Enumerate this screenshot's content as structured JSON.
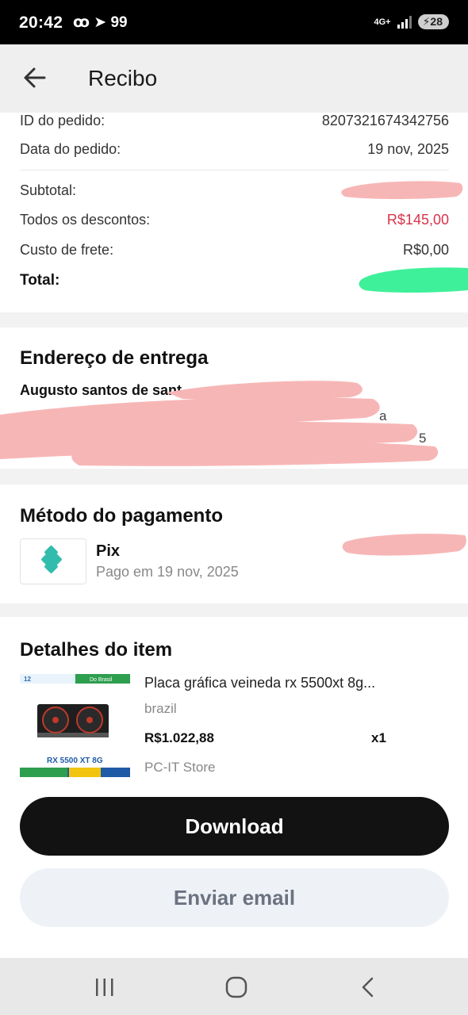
{
  "status_bar": {
    "time": "20:42",
    "icons_text": "ꝏ ➤ 99",
    "network": "4G+",
    "battery": "28"
  },
  "header": {
    "back_icon": "arrow-left-icon",
    "title": "Recibo"
  },
  "summary": {
    "order_id_label": "ID do pedido:",
    "order_id_value": "8207321674342756",
    "order_date_label": "Data do pedido:",
    "order_date_value": "19 nov, 2025",
    "subtotal_label": "Subtotal:",
    "discounts_label": "Todos os descontos:",
    "discounts_value": "R$145,00",
    "shipping_label": "Custo de frete:",
    "shipping_value": "R$0,00",
    "total_label": "Total:",
    "discount_color": "#d8334a"
  },
  "address": {
    "title": "Endereço de entrega",
    "name": "Augusto santos de sant",
    "line1_tail": "a",
    "line2_tail": "5"
  },
  "payment": {
    "title": "Método do pagamento",
    "method": "Pix",
    "paid_on": "Pago em 19 nov, 2025",
    "icon": "pix-icon",
    "brand_color": "#32bcad"
  },
  "item": {
    "title": "Detalhes do item",
    "name": "Placa gráfica veineda rx 5500xt 8g...",
    "variant": "brazil",
    "price": "R$1.022,88",
    "quantity": "x1",
    "store": "PC-IT Store",
    "thumb_text_top": "12",
    "thumb_text_brasil": "Do Brasil",
    "thumb_model": "RX 5500 XT 8G"
  },
  "actions": {
    "download_label": "Download",
    "email_label": "Enviar email"
  },
  "nav": {
    "recent_icon": "recent-apps-icon",
    "home_icon": "home-icon",
    "back_icon": "nav-back-icon"
  },
  "redaction_colors": {
    "pink": "#f7b6b6",
    "green": "#3ff09a"
  }
}
